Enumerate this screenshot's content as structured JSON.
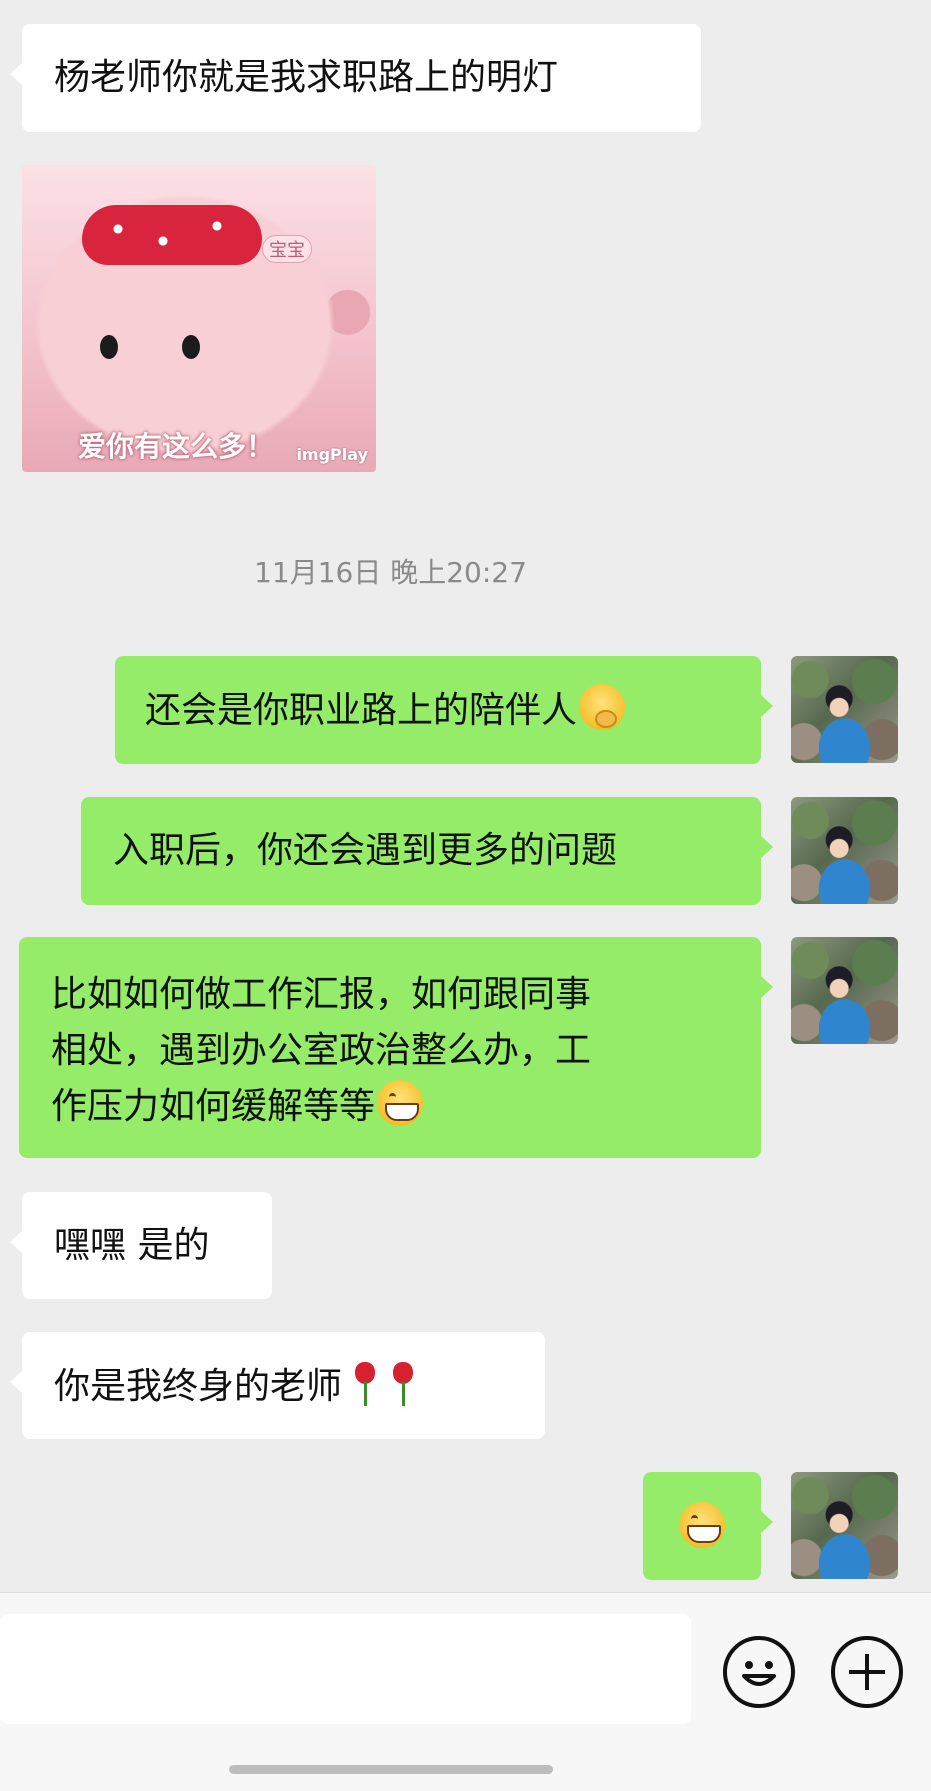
{
  "messages": {
    "m1": {
      "direction": "incoming",
      "text": "杨老师你就是我求职路上的明灯"
    },
    "sticker": {
      "direction": "incoming",
      "caption": "爱你有这么多！",
      "watermark": "imgPlay",
      "tag": "宝宝"
    },
    "timestamp": "11月16日 晚上20:27",
    "m3": {
      "direction": "outgoing",
      "text": "还会是你职业路上的陪伴人",
      "emoji": "hand-over-mouth-emoji"
    },
    "m4": {
      "direction": "outgoing",
      "text": "入职后，你还会遇到更多的问题"
    },
    "m5": {
      "direction": "outgoing",
      "line1": "比如如何做工作汇报，如何跟同事",
      "line2": "相处，遇到办公室政治整么办，工",
      "line3": "作压力如何缓解等等",
      "emoji": "grinning-emoji"
    },
    "m6": {
      "direction": "incoming",
      "text": "嘿嘿 是的"
    },
    "m7": {
      "direction": "incoming",
      "text": "你是我终身的老师",
      "emoji": "rose-emoji"
    },
    "m8": {
      "direction": "outgoing",
      "emoji": "grinning-emoji"
    }
  },
  "input_bar": {
    "emoji_icon": "smiley-face-icon",
    "plus_icon": "plus-circle-icon"
  },
  "colors": {
    "background": "#ededed",
    "incoming_bubble": "#ffffff",
    "outgoing_bubble": "#95ec69",
    "timestamp_text": "#8a8a8a"
  }
}
